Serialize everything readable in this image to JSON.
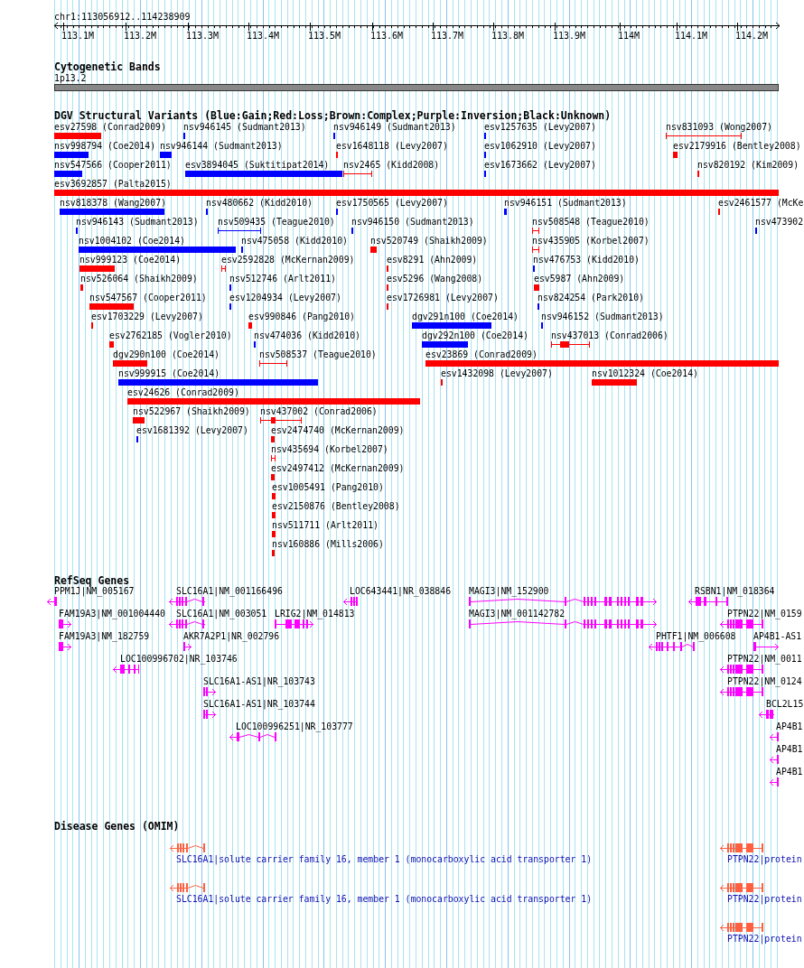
{
  "ruler": {
    "title": "chr1:113056912..114238909",
    "ticks": [
      "113.1M",
      "113.2M",
      "113.3M",
      "113.4M",
      "113.5M",
      "113.6M",
      "113.7M",
      "113.8M",
      "113.9M",
      "114M",
      "114.1M",
      "114.2M"
    ]
  },
  "tracks": [
    {
      "kind": "bands",
      "title": "Cytogenetic Bands",
      "features": [
        {
          "label": "1p13.2"
        }
      ]
    },
    {
      "kind": "variants",
      "title": "DGV Structural Variants (Blue:Gain;Red:Loss;Brown:Complex;Purple:Inversion;Black:Unknown)",
      "features": [
        {
          "label": "esv27598 (Conrad2009)",
          "color": "#ff0000",
          "kind": "block"
        },
        {
          "label": "nsv946145 (Sudmant2013)",
          "color": "#0000ff",
          "kind": "block"
        },
        {
          "label": "nsv946149 (Sudmant2013)",
          "color": "#0000ff",
          "kind": "block"
        },
        {
          "label": "esv1257635 (Levy2007)",
          "color": "#0000ff",
          "kind": "block"
        },
        {
          "label": "nsv831093 (Wong2007)",
          "color": "#ff0000",
          "kind": "interval"
        },
        {
          "label": "nsv998794 (Coe2014)",
          "color": "#0000ff",
          "kind": "block"
        },
        {
          "label": "nsv946144 (Sudmant2013)",
          "color": "#0000ff",
          "kind": "block"
        },
        {
          "label": "esv1648118 (Levy2007)",
          "color": "#ff0000",
          "kind": "block"
        },
        {
          "label": "esv1062910 (Levy2007)",
          "color": "#0000ff",
          "kind": "block"
        },
        {
          "label": "esv2179916 (Bentley2008)",
          "color": "#ff0000",
          "kind": "block"
        },
        {
          "label": "nsv547566 (Cooper2011)",
          "color": "#0000ff",
          "kind": "block"
        },
        {
          "label": "esv3894045 (Suktitipat2014)",
          "color": "#0000ff",
          "kind": "block"
        },
        {
          "label": "nsv2465 (Kidd2008)",
          "color": "#ff0000",
          "kind": "interval"
        },
        {
          "label": "esv1673662 (Levy2007)",
          "color": "#0000ff",
          "kind": "block"
        },
        {
          "label": "nsv820192 (Kim2009)",
          "color": "#ff0000",
          "kind": "block"
        },
        {
          "label": "esv3692857 (Palta2015)",
          "color": "#ff0000",
          "kind": "block"
        },
        {
          "label": "nsv818378 (Wang2007)",
          "color": "#0000ff",
          "kind": "block"
        },
        {
          "label": "nsv480662 (Kidd2010)",
          "color": "#0000ff",
          "kind": "block"
        },
        {
          "label": "esv1750565 (Levy2007)",
          "color": "#0000ff",
          "kind": "block"
        },
        {
          "label": "nsv946151 (Sudmant2013)",
          "color": "#0000ff",
          "kind": "block"
        },
        {
          "label": "esv2461577 (McKe",
          "color": "#ff0000",
          "kind": "block"
        },
        {
          "label": "nsv946143 (Sudmant2013)",
          "color": "#0000ff",
          "kind": "block"
        },
        {
          "label": "nsv509435 (Teague2010)",
          "color": "#0000ff",
          "kind": "interval"
        },
        {
          "label": "nsv946150 (Sudmant2013)",
          "color": "#0000ff",
          "kind": "block"
        },
        {
          "label": "nsv508548 (Teague2010)",
          "color": "#ff0000",
          "kind": "interval"
        },
        {
          "label": "nsv473902",
          "color": "#0000ff",
          "kind": "block"
        },
        {
          "label": "nsv1004102 (Coe2014)",
          "color": "#0000ff",
          "kind": "block"
        },
        {
          "label": "nsv475058 (Kidd2010)",
          "color": "#0000ff",
          "kind": "block"
        },
        {
          "label": "nsv520749 (Shaikh2009)",
          "color": "#ff0000",
          "kind": "block"
        },
        {
          "label": "nsv435905 (Korbel2007)",
          "color": "#ff0000",
          "kind": "interval"
        },
        {
          "label": "nsv999123 (Coe2014)",
          "color": "#ff0000",
          "kind": "block"
        },
        {
          "label": "esv2592828 (McKernan2009)",
          "color": "#ff0000",
          "kind": "interval"
        },
        {
          "label": "esv8291 (Ahn2009)",
          "color": "#ff0000",
          "kind": "block"
        },
        {
          "label": "nsv476753 (Kidd2010)",
          "color": "#0000ff",
          "kind": "block"
        },
        {
          "label": "nsv526064 (Shaikh2009)",
          "color": "#ff0000",
          "kind": "block"
        },
        {
          "label": "nsv512746 (Arlt2011)",
          "color": "#0000ff",
          "kind": "block"
        },
        {
          "label": "esv5296 (Wang2008)",
          "color": "#ff0000",
          "kind": "block"
        },
        {
          "label": "esv5987 (Ahn2009)",
          "color": "#ff0000",
          "kind": "block"
        },
        {
          "label": "nsv547567 (Cooper2011)",
          "color": "#ff0000",
          "kind": "block"
        },
        {
          "label": "esv1204934 (Levy2007)",
          "color": "#0000ff",
          "kind": "block"
        },
        {
          "label": "esv1726981 (Levy2007)",
          "color": "#ff0000",
          "kind": "block"
        },
        {
          "label": "nsv824254 (Park2010)",
          "color": "#0000ff",
          "kind": "block"
        },
        {
          "label": "esv1703229 (Levy2007)",
          "color": "#ff0000",
          "kind": "block"
        },
        {
          "label": "esv990846 (Pang2010)",
          "color": "#ff0000",
          "kind": "block"
        },
        {
          "label": "dgv291n100 (Coe2014)",
          "color": "#0000ff",
          "kind": "block"
        },
        {
          "label": "nsv946152 (Sudmant2013)",
          "color": "#0000ff",
          "kind": "block"
        },
        {
          "label": "esv2762185 (Vogler2010)",
          "color": "#ff0000",
          "kind": "block"
        },
        {
          "label": "nsv474036 (Kidd2010)",
          "color": "#0000ff",
          "kind": "block"
        },
        {
          "label": "dgv292n100 (Coe2014)",
          "color": "#0000ff",
          "kind": "block"
        },
        {
          "label": "nsv437013 (Conrad2006)",
          "color": "#ff0000",
          "kind": "mixed"
        },
        {
          "label": "dgv290n100 (Coe2014)",
          "color": "#ff0000",
          "kind": "block"
        },
        {
          "label": "nsv508537 (Teague2010)",
          "color": "#ff0000",
          "kind": "interval"
        },
        {
          "label": "esv23869 (Conrad2009)",
          "color": "#ff0000",
          "kind": "block"
        },
        {
          "label": "nsv999915 (Coe2014)",
          "color": "#0000ff",
          "kind": "block"
        },
        {
          "label": "esv1432098 (Levy2007)",
          "color": "#ff0000",
          "kind": "block"
        },
        {
          "label": "nsv1012324 (Coe2014)",
          "color": "#ff0000",
          "kind": "block"
        },
        {
          "label": "esv24626 (Conrad2009)",
          "color": "#ff0000",
          "kind": "block"
        },
        {
          "label": "nsv522967 (Shaikh2009)",
          "color": "#ff0000",
          "kind": "block"
        },
        {
          "label": "nsv437002 (Conrad2006)",
          "color": "#ff0000",
          "kind": "mixed"
        },
        {
          "label": "esv1681392 (Levy2007)",
          "color": "#0000ff",
          "kind": "block"
        },
        {
          "label": "esv2474740 (McKernan2009)",
          "color": "#ff0000",
          "kind": "block"
        },
        {
          "label": "nsv435694 (Korbel2007)",
          "color": "#ff0000",
          "kind": "interval"
        },
        {
          "label": "esv2497412 (McKernan2009)",
          "color": "#ff0000",
          "kind": "block"
        },
        {
          "label": "esv1005491 (Pang2010)",
          "color": "#ff0000",
          "kind": "block"
        },
        {
          "label": "esv2150876 (Bentley2008)",
          "color": "#ff0000",
          "kind": "block"
        },
        {
          "label": "nsv511711 (Arlt2011)",
          "color": "#ff0000",
          "kind": "block"
        },
        {
          "label": "nsv160886 (Mills2006)",
          "color": "#ff0000",
          "kind": "block"
        }
      ]
    },
    {
      "kind": "genes",
      "title": "RefSeq Genes",
      "features": [
        {
          "label": "PPM1J|NM_005167",
          "kind": "reverse"
        },
        {
          "label": "SLC16A1|NM_001166496",
          "kind": "reverse"
        },
        {
          "label": "LOC643441|NR_038846",
          "kind": "reverse"
        },
        {
          "label": "MAGI3|NM_152900",
          "kind": "forward"
        },
        {
          "label": "RSBN1|NM_018364",
          "kind": "reverse"
        },
        {
          "label": "FAM19A3|NM_001004440",
          "kind": "forward"
        },
        {
          "label": "SLC16A1|NM_003051",
          "kind": "reverse"
        },
        {
          "label": "LRIG2|NM_014813",
          "kind": "forward"
        },
        {
          "label": "MAGI3|NM_001142782",
          "kind": "forward"
        },
        {
          "label": "PTPN22|NM_0159",
          "kind": "reverse"
        },
        {
          "label": "FAM19A3|NM_182759",
          "kind": "forward"
        },
        {
          "label": "AKR7A2P1|NR_002796",
          "kind": "forward"
        },
        {
          "label": "PHTF1|NM_006608",
          "kind": "reverse"
        },
        {
          "label": "AP4B1-AS1",
          "kind": "forward"
        },
        {
          "label": "LOC100996702|NR_103746",
          "kind": "reverse"
        },
        {
          "label": "PTPN22|NM_0011",
          "kind": "reverse"
        },
        {
          "label": "SLC16A1-AS1|NR_103743",
          "kind": "forward"
        },
        {
          "label": "PTPN22|NM_0124",
          "kind": "reverse"
        },
        {
          "label": "SLC16A1-AS1|NR_103744",
          "kind": "forward"
        },
        {
          "label": "BCL2L15",
          "kind": "reverse"
        },
        {
          "label": "LOC100996251|NR_103777",
          "kind": "reverse"
        },
        {
          "label": "AP4B1",
          "kind": "reverse"
        },
        {
          "label": "AP4B1",
          "kind": "reverse"
        },
        {
          "label": "AP4B1",
          "kind": "reverse"
        }
      ]
    },
    {
      "kind": "disease",
      "title": "Disease Genes (OMIM)",
      "features": [
        {
          "label": "SLC16A1|solute carrier family 16, member 1 (monocarboxylic acid transporter 1)",
          "kind": "reverse"
        },
        {
          "label": "PTPN22|protein",
          "kind": "reverse"
        },
        {
          "label": "SLC16A1|solute carrier family 16, member 1 (monocarboxylic acid transporter 1)",
          "kind": "reverse"
        },
        {
          "label": "PTPN22|protein",
          "kind": "reverse"
        },
        {
          "label": "PTPN22|protein",
          "kind": "reverse"
        }
      ]
    }
  ]
}
